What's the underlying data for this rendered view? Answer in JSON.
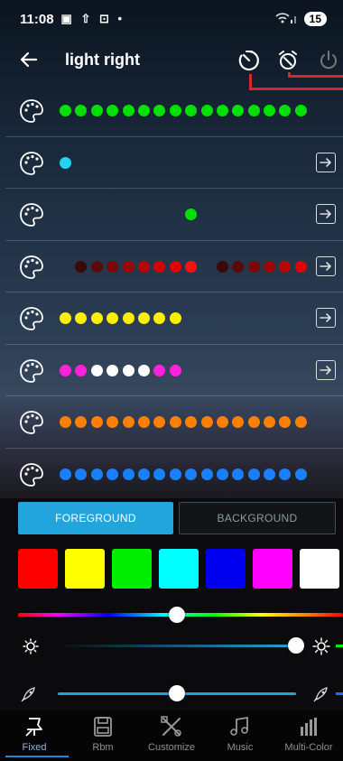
{
  "status": {
    "time": "11:08",
    "battery": "15"
  },
  "header": {
    "title": "light right"
  },
  "presets": [
    {
      "has_arrow": false,
      "dots": [
        "#00e000",
        "#00e000",
        "#00e000",
        "#00e000",
        "#00e000",
        "#00e000",
        "#00e000",
        "#00e000",
        "#00e000",
        "#00e000",
        "#00e000",
        "#00e000",
        "#00e000",
        "#00e000",
        "#00e000",
        "#00e000"
      ]
    },
    {
      "has_arrow": true,
      "dots": [
        "#22d4f0"
      ]
    },
    {
      "has_arrow": true,
      "offset": 8,
      "dots": [
        "#00e000"
      ]
    },
    {
      "has_arrow": true,
      "offset": 1,
      "dots": [
        "#3a0a0a",
        "#5a0a0a",
        "#7a0808",
        "#990808",
        "#b80606",
        "#d00404",
        "#e00000",
        "#ff1010",
        "",
        "#3a0a0a",
        "#5a0a0a",
        "#7a0808",
        "#990808",
        "#b80606",
        "#e00000"
      ]
    },
    {
      "has_arrow": true,
      "dots": [
        "#ffee00",
        "#ffee00",
        "#ffee00",
        "#ffee00",
        "#ffee00",
        "#ffee00",
        "#ffee00",
        "#ffee00"
      ]
    },
    {
      "has_arrow": true,
      "dots": [
        "#ff22dd",
        "#ff22dd",
        "#ffffff",
        "#ffffff",
        "#ffffff",
        "#ffffff",
        "#ff22dd",
        "#ff22dd"
      ]
    },
    {
      "has_arrow": false,
      "dots": [
        "#ff8000",
        "#ff8000",
        "#ff8000",
        "#ff8000",
        "#ff8000",
        "#ff8000",
        "#ff8000",
        "#ff8000",
        "#ff8000",
        "#ff8000",
        "#ff8000",
        "#ff8000",
        "#ff8000",
        "#ff8000",
        "#ff8000",
        "#ff8000"
      ]
    },
    {
      "has_arrow": false,
      "dots": [
        "#1a7fff",
        "#1a7fff",
        "#1a7fff",
        "#1a7fff",
        "#1a7fff",
        "#1a7fff",
        "#1a7fff",
        "#1a7fff",
        "#1a7fff",
        "#1a7fff",
        "#1a7fff",
        "#1a7fff",
        "#1a7fff",
        "#1a7fff",
        "#1a7fff",
        "#1a7fff"
      ]
    }
  ],
  "tabs": {
    "foreground": "FOREGROUND",
    "background": "BACKGROUND"
  },
  "swatches": [
    "#ff0000",
    "#ffff00",
    "#00ee00",
    "#00ffff",
    "#0000ee",
    "#ff00ff",
    "#ffffff"
  ],
  "sliders": {
    "hue": 0.5,
    "brightness": 1.0,
    "speed": 0.5
  },
  "nav": [
    {
      "label": "Fixed",
      "icon": "pin-icon",
      "active": true
    },
    {
      "label": "Rbm",
      "icon": "save-icon",
      "active": false
    },
    {
      "label": "Customize",
      "icon": "tools-icon",
      "active": false
    },
    {
      "label": "Music",
      "icon": "music-note-icon",
      "active": false
    },
    {
      "label": "Multi-Color",
      "icon": "bars-icon",
      "active": false
    }
  ],
  "accent": "#22a4dd"
}
